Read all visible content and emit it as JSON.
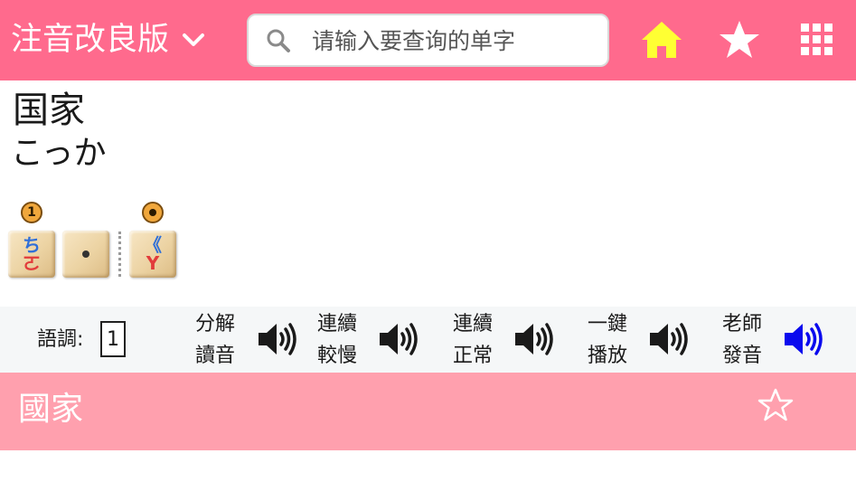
{
  "header": {
    "title": "注音改良版",
    "search_placeholder": "请输入要查询的单字",
    "colors": {
      "background": "#ff6a8d",
      "home_icon": "#ffff33",
      "icons": "#ffffff"
    },
    "icons": [
      "chevron-down-icon",
      "search-icon",
      "home-icon",
      "star-icon",
      "grid-icon"
    ]
  },
  "word": {
    "kanji": "国家",
    "kana": "こっか"
  },
  "tiles": {
    "tone_badges": [
      "1",
      "●"
    ],
    "items": [
      {
        "top": "ち",
        "bottom": "ㄛ"
      },
      {
        "top": "·",
        "bottom": ""
      },
      {
        "top": "《",
        "bottom": "Y"
      }
    ]
  },
  "controls": {
    "tone_label": "語調:",
    "tone_value": "1",
    "items": [
      {
        "line1": "分解",
        "line2": "讀音",
        "icon": "speaker-icon",
        "color": "#1a1a1a"
      },
      {
        "line1": "連續",
        "line2": "較慢",
        "icon": "speaker-icon",
        "color": "#1a1a1a"
      },
      {
        "line1": "連續",
        "line2": "正常",
        "icon": "speaker-icon",
        "color": "#1a1a1a"
      },
      {
        "line1": "一鍵",
        "line2": "播放",
        "icon": "speaker-icon",
        "color": "#1a1a1a"
      },
      {
        "line1": "老師",
        "line2": "發音",
        "icon": "speaker-icon",
        "color": "#0a0aee"
      }
    ]
  },
  "traditional": {
    "word": "國家",
    "background": "#ffa0ae",
    "icon": "star-outline-icon"
  }
}
